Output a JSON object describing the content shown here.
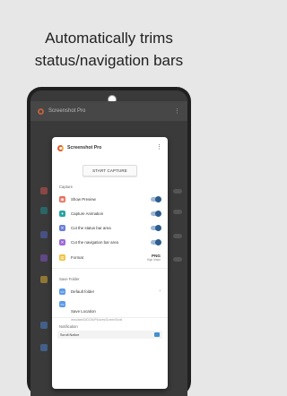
{
  "headline": {
    "line1": "Automatically trims",
    "line2": "status/navigation bars"
  },
  "background_app": {
    "title": "Screenshot Pro",
    "menu_glyph": "⋮"
  },
  "dialog": {
    "title": "Screenshot Pro",
    "menu_glyph": "⋮",
    "start_capture_label": "START CAPTURE",
    "capture_section": "Capture",
    "rows": [
      {
        "label": "Show Preview",
        "icon_color": "#e96a5a",
        "icon": "preview-icon",
        "toggle_on": true
      },
      {
        "label": "Capture Animation",
        "icon_color": "#27a4a2",
        "icon": "animation-icon",
        "toggle_on": true
      },
      {
        "label": "Cut the status bar area",
        "icon_color": "#6a7fd9",
        "icon": "crop-icon",
        "toggle_on": true
      },
      {
        "label": "Cut the navigation bar area",
        "icon_color": "#9a6ad9",
        "icon": "crop-nav-icon",
        "toggle_on": true
      }
    ],
    "format": {
      "label": "Format",
      "icon_color": "#f0c040",
      "value": "PNG",
      "sub": "High Make"
    },
    "save_folder_section": "Save Folder",
    "default_folder": {
      "label": "Default folder",
      "icon_color": "#5a9ae8"
    },
    "save_location": {
      "label": "Save Location",
      "path": "/emulated/0/DCIM/Pictures/ScreenShots",
      "icon_color": "#5a9ae8"
    },
    "notification_section": "Notification",
    "notification_text": "Scroll Notice"
  }
}
